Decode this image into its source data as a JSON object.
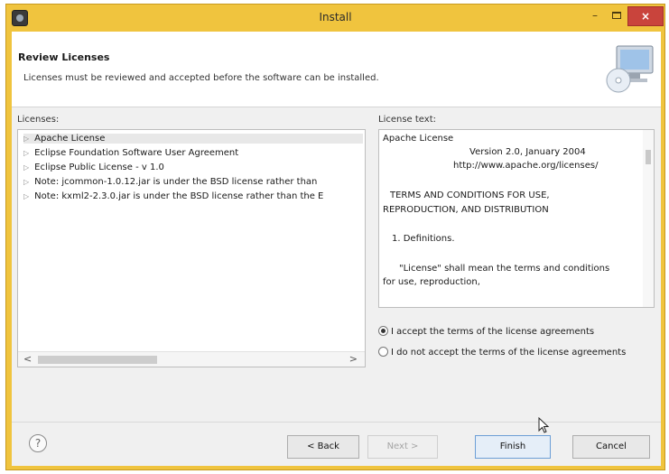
{
  "window": {
    "title": "Install",
    "minimize_label": "–",
    "close_label": "×"
  },
  "header": {
    "title": "Review Licenses",
    "subtitle": "Licenses must be reviewed and accepted before the software can be installed."
  },
  "licenses": {
    "label": "Licenses:",
    "items": [
      {
        "label": "Apache License"
      },
      {
        "label": "Eclipse Foundation Software User Agreement"
      },
      {
        "label": "Eclipse Public License - v 1.0"
      },
      {
        "label": "Note:  jcommon-1.0.12.jar is under the BSD license rather than"
      },
      {
        "label": "Note:  kxml2-2.3.0.jar is under the BSD license rather than the E"
      }
    ],
    "scroll_left": "<",
    "scroll_right": ">"
  },
  "license_text": {
    "label": "License text:",
    "lines": [
      "Apache License",
      "Version 2.0, January 2004",
      "http://www.apache.org/licenses/",
      "TERMS AND CONDITIONS FOR USE,",
      "REPRODUCTION, AND DISTRIBUTION",
      "1. Definitions.",
      "\"License\" shall mean the terms and conditions",
      "for use, reproduction,"
    ]
  },
  "acceptance": {
    "accept_label": "I accept the terms of the license agreements",
    "decline_label": "I do not accept the terms of the license agreements",
    "selected": "accept"
  },
  "footer": {
    "help_label": "?",
    "back_label": "< Back",
    "next_label": "Next >",
    "finish_label": "Finish",
    "cancel_label": "Cancel"
  },
  "colors": {
    "title_bar": "#f0c43e",
    "close_button": "#c9443c",
    "dialog_background": "#f0f0f0"
  }
}
